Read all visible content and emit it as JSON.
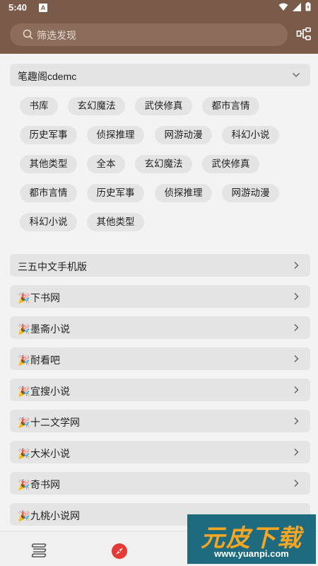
{
  "status_bar": {
    "time": "5:40",
    "notification_badge": "A"
  },
  "search": {
    "placeholder": "筛选发现"
  },
  "group": {
    "title": "笔趣阁cdemc",
    "chips": [
      "书库",
      "玄幻魔法",
      "武侠修真",
      "都市言情",
      "历史军事",
      "侦探推理",
      "网游动漫",
      "科幻小说",
      "其他类型",
      "全本",
      "玄幻魔法",
      "武侠修真",
      "都市言情",
      "历史军事",
      "侦探推理",
      "网游动漫",
      "科幻小说",
      "其他类型"
    ]
  },
  "sources": [
    {
      "label": "三五中文手机版",
      "party": false
    },
    {
      "label": "下书网",
      "party": true
    },
    {
      "label": "墨斋小说",
      "party": true
    },
    {
      "label": "耐看吧",
      "party": true
    },
    {
      "label": "宜搜小说",
      "party": true
    },
    {
      "label": "十二文学网",
      "party": true
    },
    {
      "label": "大米小说",
      "party": true
    },
    {
      "label": "奇书网",
      "party": true
    },
    {
      "label": "九桃小说网",
      "party": true
    }
  ],
  "bottom_nav": {
    "items": [
      "bookshelf-icon",
      "compass-icon",
      "rss-icon"
    ],
    "active": "compass-icon"
  },
  "watermark": {
    "main": "元皮下载",
    "url": "www.yuanpi.com"
  },
  "colors": {
    "toolbar": "#7a5a48",
    "accent": "#e53935",
    "card": "#e4e4e4"
  }
}
